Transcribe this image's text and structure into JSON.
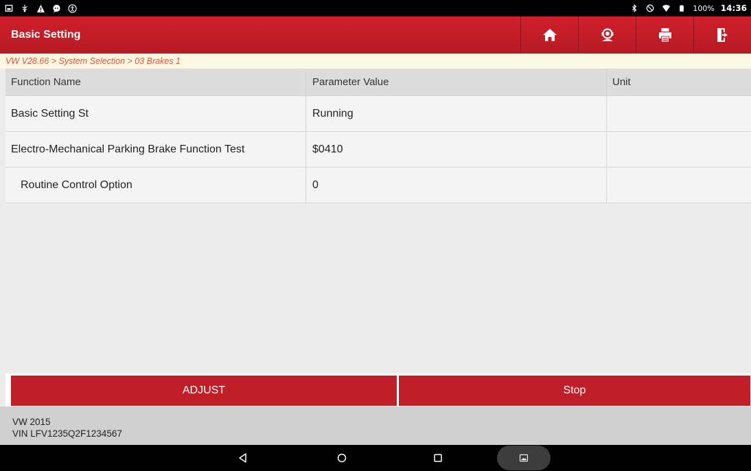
{
  "status_bar": {
    "left_icons": [
      "notification-icon",
      "usb-icon",
      "warning-icon",
      "chat-icon",
      "accessibility-icon"
    ],
    "right_icons": [
      "bluetooth-icon",
      "dnd-icon",
      "wifi-icon",
      "battery-icon"
    ],
    "battery": "100%",
    "time": "14:36"
  },
  "header": {
    "title": "Basic Setting",
    "buttons": [
      "home-icon",
      "support-icon",
      "print-icon",
      "exit-icon"
    ],
    "accent": "#c01e29"
  },
  "breadcrumb": "VW V28.66 > System Selection > 03 Brakes 1",
  "table": {
    "columns": [
      "Function Name",
      "Parameter Value",
      "Unit"
    ],
    "rows": [
      {
        "name": "Basic Setting St",
        "value": "Running",
        "unit": ""
      },
      {
        "name": "Electro-Mechanical Parking Brake Function Test",
        "value": "$0410",
        "unit": ""
      },
      {
        "name": "Routine Control Option",
        "value": "0",
        "unit": ""
      }
    ]
  },
  "actions": {
    "adjust": "ADJUST",
    "stop": "Stop"
  },
  "vehicle": {
    "model_line": "VW 2015",
    "vin_line": "VIN LFV1235Q2F1234567"
  },
  "nav": [
    "back-icon",
    "home-circle-icon",
    "recents-icon",
    "gallery-icon"
  ]
}
